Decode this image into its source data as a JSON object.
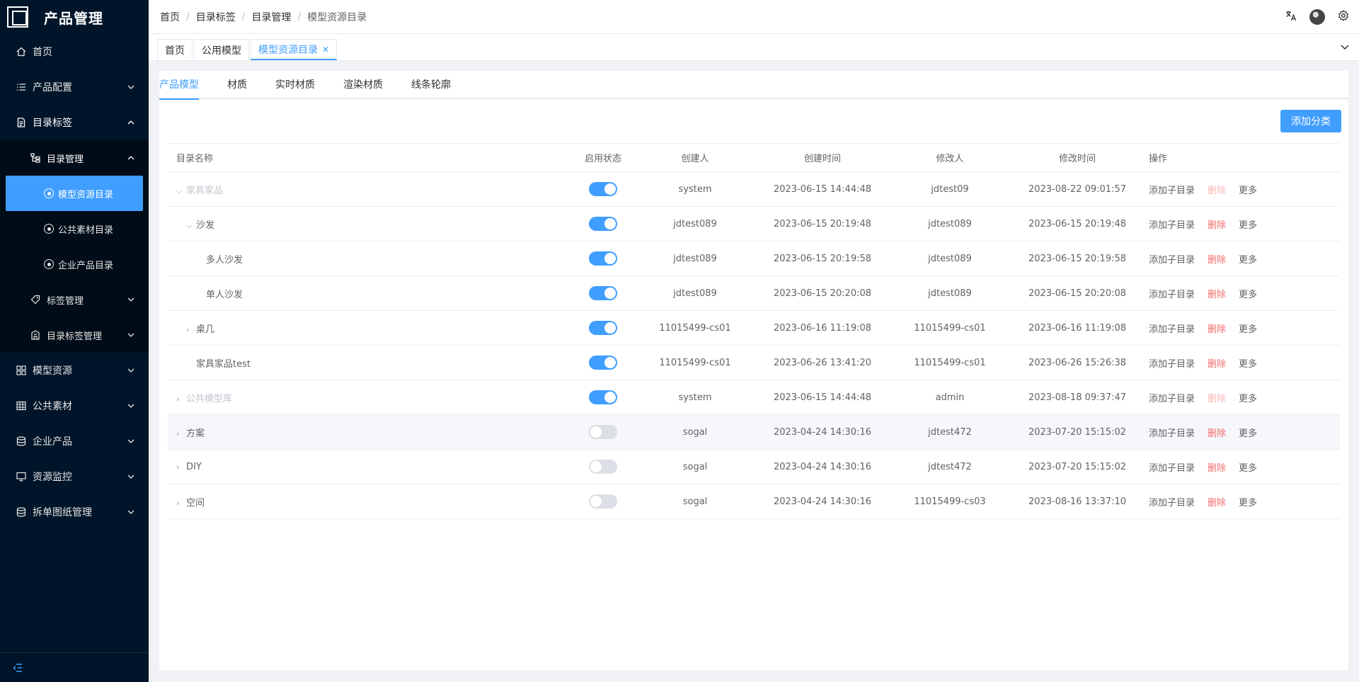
{
  "app": {
    "title": "产品管理"
  },
  "sidebar": {
    "items": [
      {
        "label": "首页",
        "icon": "home-icon"
      },
      {
        "label": "产品配置",
        "icon": "list-icon"
      },
      {
        "label": "目录标签",
        "icon": "document-icon"
      },
      {
        "label": "目录管理",
        "icon": "tree-icon"
      },
      {
        "label": "模型资源目录",
        "icon": "radio-icon"
      },
      {
        "label": "公共素材目录",
        "icon": "radio-icon"
      },
      {
        "label": "企业产品目录",
        "icon": "radio-icon"
      },
      {
        "label": "标签管理",
        "icon": "tag-icon"
      },
      {
        "label": "目录标签管理",
        "icon": "building-icon"
      },
      {
        "label": "模型资源",
        "icon": "grid-icon"
      },
      {
        "label": "公共素材",
        "icon": "table-icon"
      },
      {
        "label": "企业产品",
        "icon": "database-icon"
      },
      {
        "label": "资源监控",
        "icon": "monitor-icon"
      },
      {
        "label": "拆单图纸管理",
        "icon": "database-icon"
      }
    ]
  },
  "breadcrumb": [
    "首页",
    "目录标签",
    "目录管理",
    "模型资源目录"
  ],
  "tags": [
    "首页",
    "公用模型",
    "模型资源目录"
  ],
  "subtabs": [
    "产品模型",
    "材质",
    "实时材质",
    "渲染材质",
    "线条轮廓"
  ],
  "toolbar": {
    "add_label": "添加分类"
  },
  "table": {
    "headers": [
      "目录名称",
      "启用状态",
      "创建人",
      "创建时间",
      "修改人",
      "修改时间",
      "操作"
    ],
    "ops": {
      "add_child": "添加子目录",
      "delete": "删除",
      "more": "更多"
    },
    "rows": [
      {
        "name": "家具家品",
        "enabled": true,
        "creator": "system",
        "created": "2023-06-15 14:44:48",
        "modifier": "jdtest09",
        "modified": "2023-08-22 09:01:57"
      },
      {
        "name": "沙发",
        "enabled": true,
        "creator": "jdtest089",
        "created": "2023-06-15 20:19:48",
        "modifier": "jdtest089",
        "modified": "2023-06-15 20:19:48"
      },
      {
        "name": "多人沙发",
        "enabled": true,
        "creator": "jdtest089",
        "created": "2023-06-15 20:19:58",
        "modifier": "jdtest089",
        "modified": "2023-06-15 20:19:58"
      },
      {
        "name": "单人沙发",
        "enabled": true,
        "creator": "jdtest089",
        "created": "2023-06-15 20:20:08",
        "modifier": "jdtest089",
        "modified": "2023-06-15 20:20:08"
      },
      {
        "name": "桌几",
        "enabled": true,
        "creator": "11015499-cs01",
        "created": "2023-06-16 11:19:08",
        "modifier": "11015499-cs01",
        "modified": "2023-06-16 11:19:08"
      },
      {
        "name": "家具家品test",
        "enabled": true,
        "creator": "11015499-cs01",
        "created": "2023-06-26 13:41:20",
        "modifier": "11015499-cs01",
        "modified": "2023-06-26 15:26:38"
      },
      {
        "name": "公共模型库",
        "enabled": true,
        "creator": "system",
        "created": "2023-06-15 14:44:48",
        "modifier": "admin",
        "modified": "2023-08-18 09:37:47"
      },
      {
        "name": "方案",
        "enabled": false,
        "creator": "sogal",
        "created": "2023-04-24 14:30:16",
        "modifier": "jdtest472",
        "modified": "2023-07-20 15:15:02"
      },
      {
        "name": "DIY",
        "enabled": false,
        "creator": "sogal",
        "created": "2023-04-24 14:30:16",
        "modifier": "jdtest472",
        "modified": "2023-07-20 15:15:02"
      },
      {
        "name": "空间",
        "enabled": false,
        "creator": "sogal",
        "created": "2023-04-24 14:30:16",
        "modifier": "11015499-cs03",
        "modified": "2023-08-16 13:37:10"
      }
    ]
  },
  "colors": {
    "accent": "#409eff",
    "sidebar": "#001529",
    "danger": "#f56c6c"
  }
}
